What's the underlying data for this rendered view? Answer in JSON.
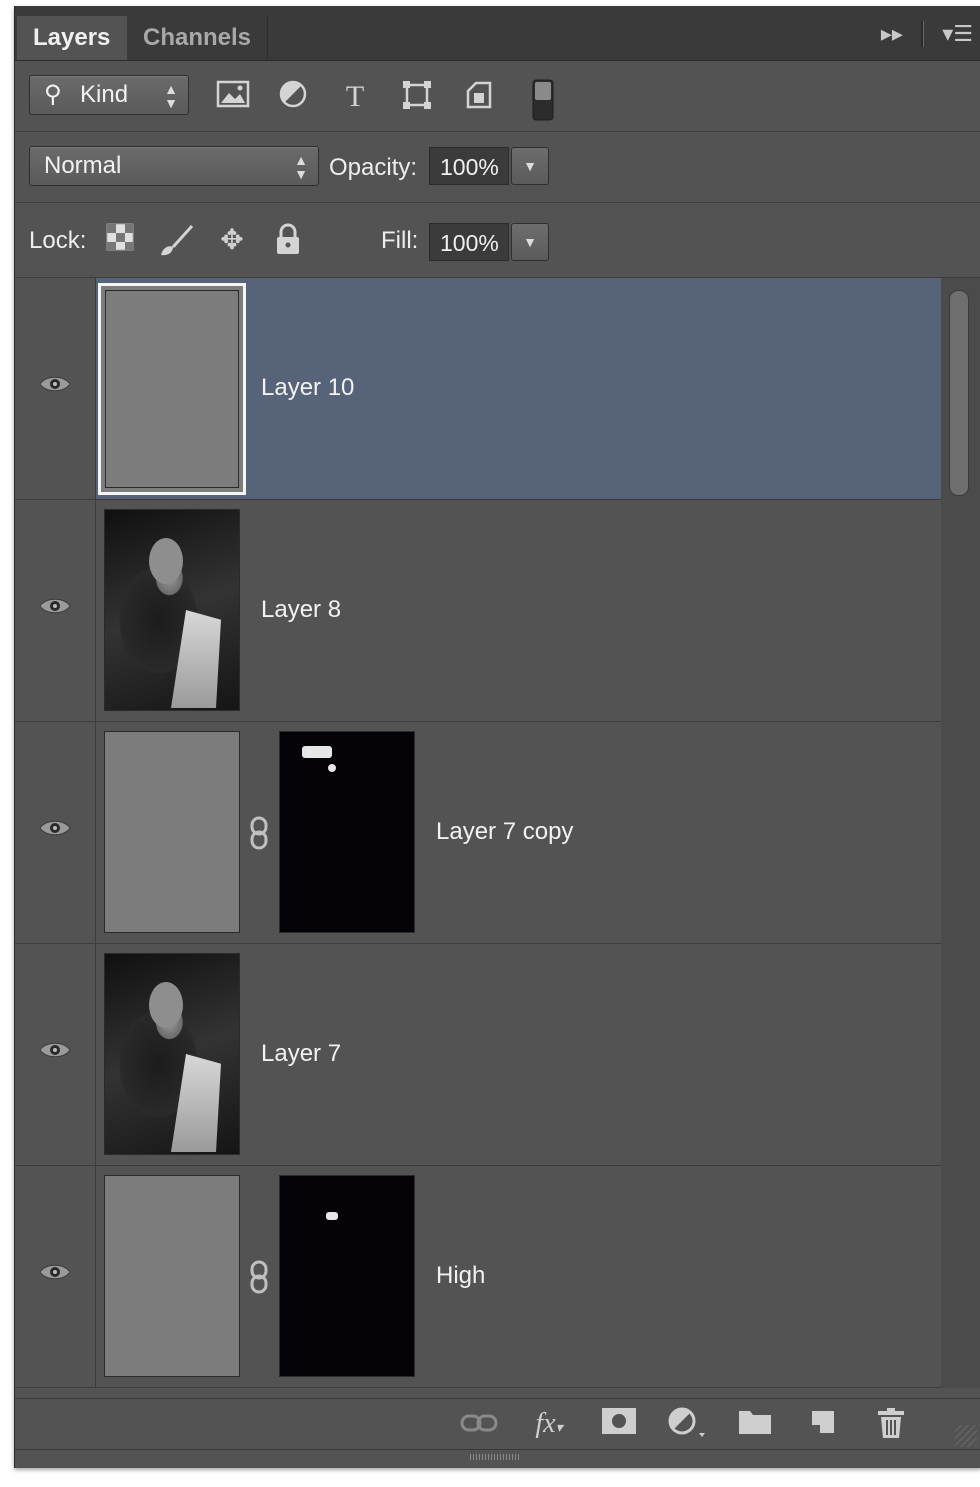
{
  "tabs": [
    {
      "label": "Layers",
      "active": true
    },
    {
      "label": "Channels",
      "active": false
    }
  ],
  "panel_controls": {
    "collapse_icon": "double-chevron-right-icon",
    "menu_icon": "panel-menu-icon"
  },
  "filter": {
    "kind_label": "Kind",
    "icons": [
      "pixel-layer-filter-icon",
      "adjustment-layer-filter-icon",
      "type-layer-filter-icon",
      "shape-layer-filter-icon",
      "smart-object-filter-icon",
      "filter-toggle-icon"
    ]
  },
  "blend": {
    "mode": "Normal",
    "opacity_label": "Opacity:",
    "opacity_value": "100%"
  },
  "lock": {
    "label": "Lock:",
    "icons": [
      "lock-transparent-pixels-icon",
      "lock-image-pixels-icon",
      "lock-position-icon",
      "lock-all-icon"
    ],
    "fill_label": "Fill:",
    "fill_value": "100%"
  },
  "layers": [
    {
      "name": "Layer 10",
      "visible": true,
      "selected": true,
      "thumb": "gray",
      "mask": false
    },
    {
      "name": "Layer 8",
      "visible": true,
      "selected": false,
      "thumb": "photo",
      "mask": false
    },
    {
      "name": "Layer 7 copy",
      "visible": true,
      "selected": false,
      "thumb": "gray",
      "mask": true
    },
    {
      "name": "Layer 7",
      "visible": true,
      "selected": false,
      "thumb": "photo",
      "mask": false
    },
    {
      "name": "High",
      "visible": true,
      "selected": false,
      "thumb": "gray",
      "mask": true
    }
  ],
  "bottom_tools": [
    "link-layers-icon",
    "fx-icon",
    "add-mask-icon",
    "new-adjustment-layer-icon",
    "new-group-icon",
    "new-layer-icon",
    "delete-layer-icon"
  ],
  "colors": {
    "panel": "#535353",
    "selected_row": "#566378",
    "tabbar": "#3a3a3a"
  }
}
